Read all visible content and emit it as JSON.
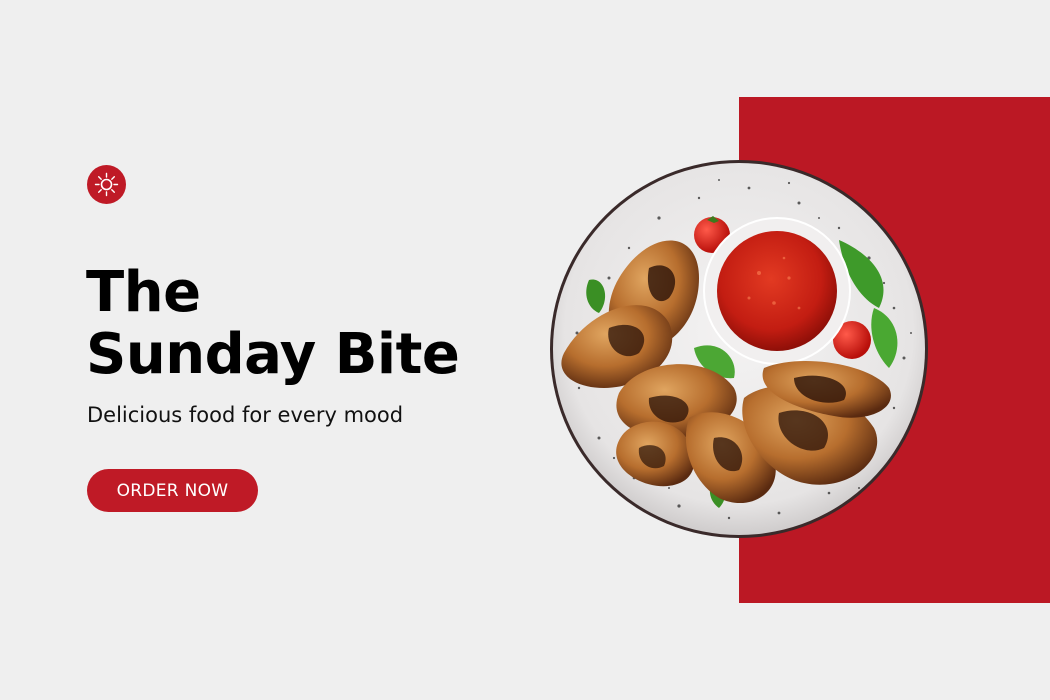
{
  "brand": {
    "logo_icon": "sun-icon",
    "accent_color": "#bf1a26"
  },
  "hero": {
    "title_line_1": "The",
    "title_line_2": "Sunday Bite",
    "tagline": "Delicious food for every mood",
    "cta_label": "ORDER NOW"
  },
  "visual": {
    "panel_color": "#bb1824",
    "image_subject": "plate of grilled chicken wings with red dipping sauce"
  }
}
